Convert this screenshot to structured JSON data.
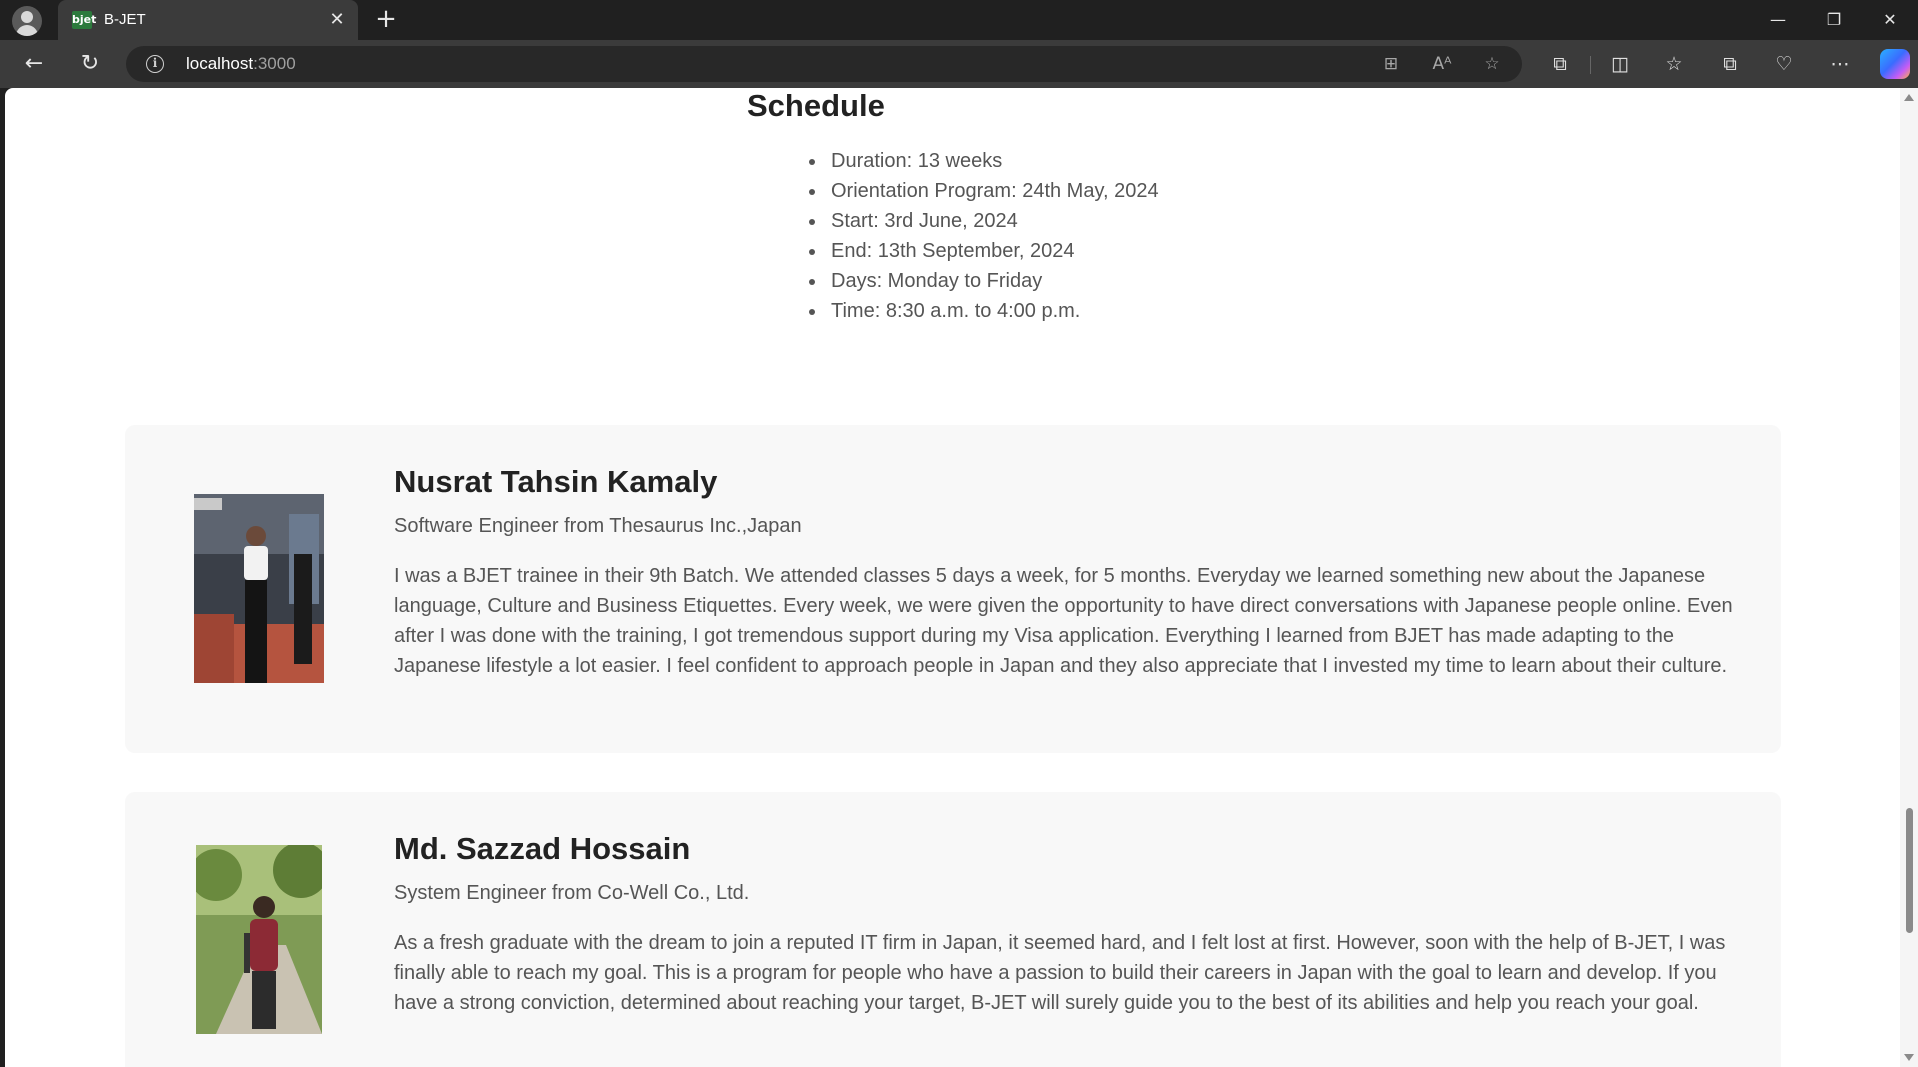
{
  "browser": {
    "tab_title": "B-JET",
    "favicon_text": "bjet",
    "url_host": "localhost",
    "url_port": ":3000"
  },
  "schedule": {
    "title": "Schedule",
    "items": [
      "Duration: 13 weeks",
      "Orientation Program: 24th May, 2024",
      "Start: 3rd June, 2024",
      "End: 13th September, 2024",
      "Days: Monday to Friday",
      "Time: 8:30 a.m. to 4:00 p.m."
    ]
  },
  "testimonials": [
    {
      "name": "Nusrat Tahsin Kamaly",
      "role": "Software Engineer from Thesaurus Inc.,Japan",
      "text": "I was a BJET trainee in their 9th Batch. We attended classes 5 days a week, for 5 months. Everyday we learned something new about the Japanese language, Culture and Business Etiquettes. Every week, we were given the opportunity to have direct conversations with Japanese people online. Even after I was done with the training, I got tremendous support during my Visa application. Everything I learned from BJET has made adapting to the Japanese lifestyle a lot easier. I feel confident to approach people in Japan and they also appreciate that I invested my time to learn about their culture."
    },
    {
      "name": "Md. Sazzad Hossain",
      "role": "System Engineer from Co-Well Co., Ltd.",
      "text": "As a fresh graduate with the dream to join a reputed IT firm in Japan, it seemed hard, and I felt lost at first. However, soon with the help of B-JET, I was finally able to reach my goal. This is a program for people who have a passion to build their careers in Japan with the goal to learn and develop. If you have a strong conviction, determined about reaching your target, B-JET will surely guide you to the best of its abilities and help you reach your goal."
    }
  ],
  "icons": {
    "back": "back-arrow-icon",
    "refresh": "refresh-icon",
    "info": "info-icon",
    "app_available": "app-available-icon",
    "read_aloud": "read-aloud-icon",
    "favorite": "star-icon",
    "extensions": "puzzle-icon",
    "split_screen": "split-screen-icon",
    "favorites": "favorites-icon",
    "collections": "collections-icon",
    "browser_essentials": "heart-pulse-icon",
    "more": "more-icon",
    "copilot": "copilot-icon"
  },
  "colors": {
    "chrome_dark": "#202020",
    "chrome_toolbar": "#3b3b3b",
    "card_bg": "#f8f8f8",
    "heading": "#222222",
    "body_text": "#555555"
  }
}
